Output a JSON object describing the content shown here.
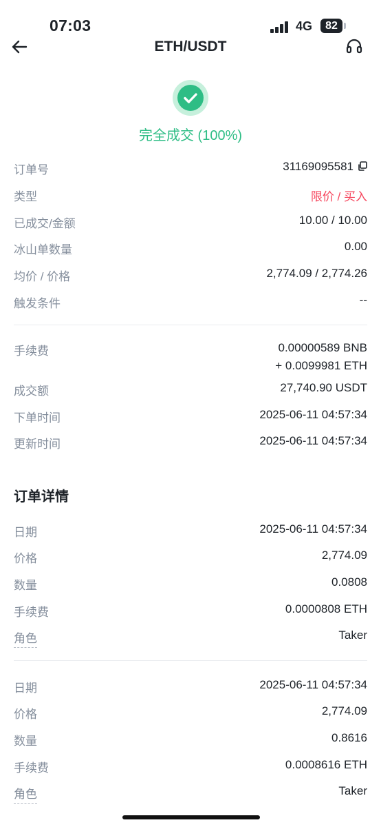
{
  "status_bar": {
    "time": "07:03",
    "network": "4G",
    "battery": "82"
  },
  "nav": {
    "title": "ETH/USDT",
    "back_icon": "arrow-left-icon",
    "support_icon": "headset-icon"
  },
  "order_status": {
    "text": "完全成交 (100%)",
    "color": "#2ebd85",
    "icon": "check-circle-icon"
  },
  "summary": {
    "order_id_label": "订单号",
    "order_id": "31169095581",
    "type_label": "类型",
    "type": "限价 / 买入",
    "filled_label": "已成交/金额",
    "filled": "10.00 / 10.00",
    "iceberg_label": "冰山单数量",
    "iceberg": "0.00",
    "avg_price_label": "均价 / 价格",
    "avg_price": "2,774.09 / 2,774.26",
    "trigger_label": "触发条件",
    "trigger": "--"
  },
  "fees": {
    "fee_label": "手续费",
    "fee_line1": "0.00000589 BNB",
    "fee_line2": "+ 0.0099981 ETH",
    "total_label": "成交额",
    "total": "27,740.90 USDT",
    "created_label": "下单时间",
    "created": "2025-06-11 04:57:34",
    "updated_label": "更新时间",
    "updated": "2025-06-11 04:57:34"
  },
  "details": {
    "title": "订单详情",
    "trades": [
      {
        "date_label": "日期",
        "date": "2025-06-11 04:57:34",
        "price_label": "价格",
        "price": "2,774.09",
        "qty_label": "数量",
        "qty": "0.0808",
        "fee_label": "手续费",
        "fee": "0.0000808 ETH",
        "role_label": "角色",
        "role": "Taker"
      },
      {
        "date_label": "日期",
        "date": "2025-06-11 04:57:34",
        "price_label": "价格",
        "price": "2,774.09",
        "qty_label": "数量",
        "qty": "0.8616",
        "fee_label": "手续费",
        "fee": "0.0008616 ETH",
        "role_label": "角色",
        "role": "Taker"
      }
    ]
  },
  "colors": {
    "accent_green": "#2ebd85",
    "sell_red": "#f6465d",
    "label_gray": "#848e9c"
  }
}
